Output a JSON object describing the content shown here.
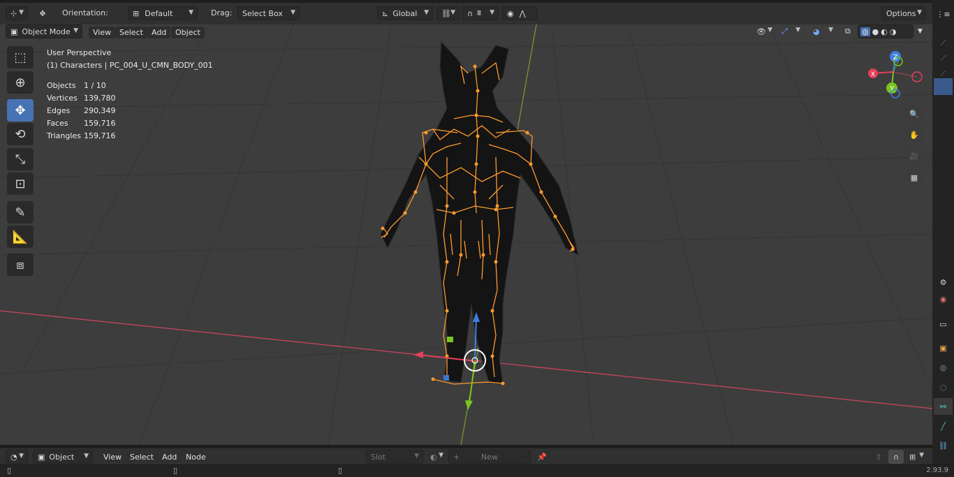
{
  "tool_header": {
    "orientation_label": "Orientation:",
    "orientation_value": "Default",
    "drag_label": "Drag:",
    "drag_value": "Select Box",
    "transform_space": "Global",
    "options_label": "Options"
  },
  "view_header": {
    "mode": "Object Mode",
    "menus": [
      "View",
      "Select",
      "Add",
      "Object"
    ]
  },
  "overlay": {
    "perspective": "User Perspective",
    "collection": "(1) Characters | PC_004_U_CMN_BODY_001",
    "stats": [
      {
        "key": "Objects",
        "value": "1 / 10"
      },
      {
        "key": "Vertices",
        "value": "139,780"
      },
      {
        "key": "Edges",
        "value": "290,349"
      },
      {
        "key": "Faces",
        "value": "159,716"
      },
      {
        "key": "Triangles",
        "value": "159,716"
      }
    ]
  },
  "gizmo": {
    "x_label": "X",
    "y_label": "Y",
    "z_label": "Z"
  },
  "toolbar_tools": [
    "select-box-icon",
    "cursor-icon",
    "move-icon",
    "rotate-icon",
    "scale-icon",
    "transform-icon",
    "annotate-icon",
    "measure-icon",
    "add-cube-icon"
  ],
  "bottom_header": {
    "editor_type": "Object",
    "menus": [
      "View",
      "Select",
      "Add",
      "Node"
    ],
    "slot_label": "Slot",
    "new_label": "New"
  },
  "status": {
    "version": "2.93.9"
  },
  "colors": {
    "accent": "#4772b3",
    "armature": "#ff9a2e",
    "x_axis": "#e2405a",
    "y_axis": "#7ac51d",
    "z_axis": "#3e7fe6",
    "viewport_bg": "#3d3d3d"
  }
}
